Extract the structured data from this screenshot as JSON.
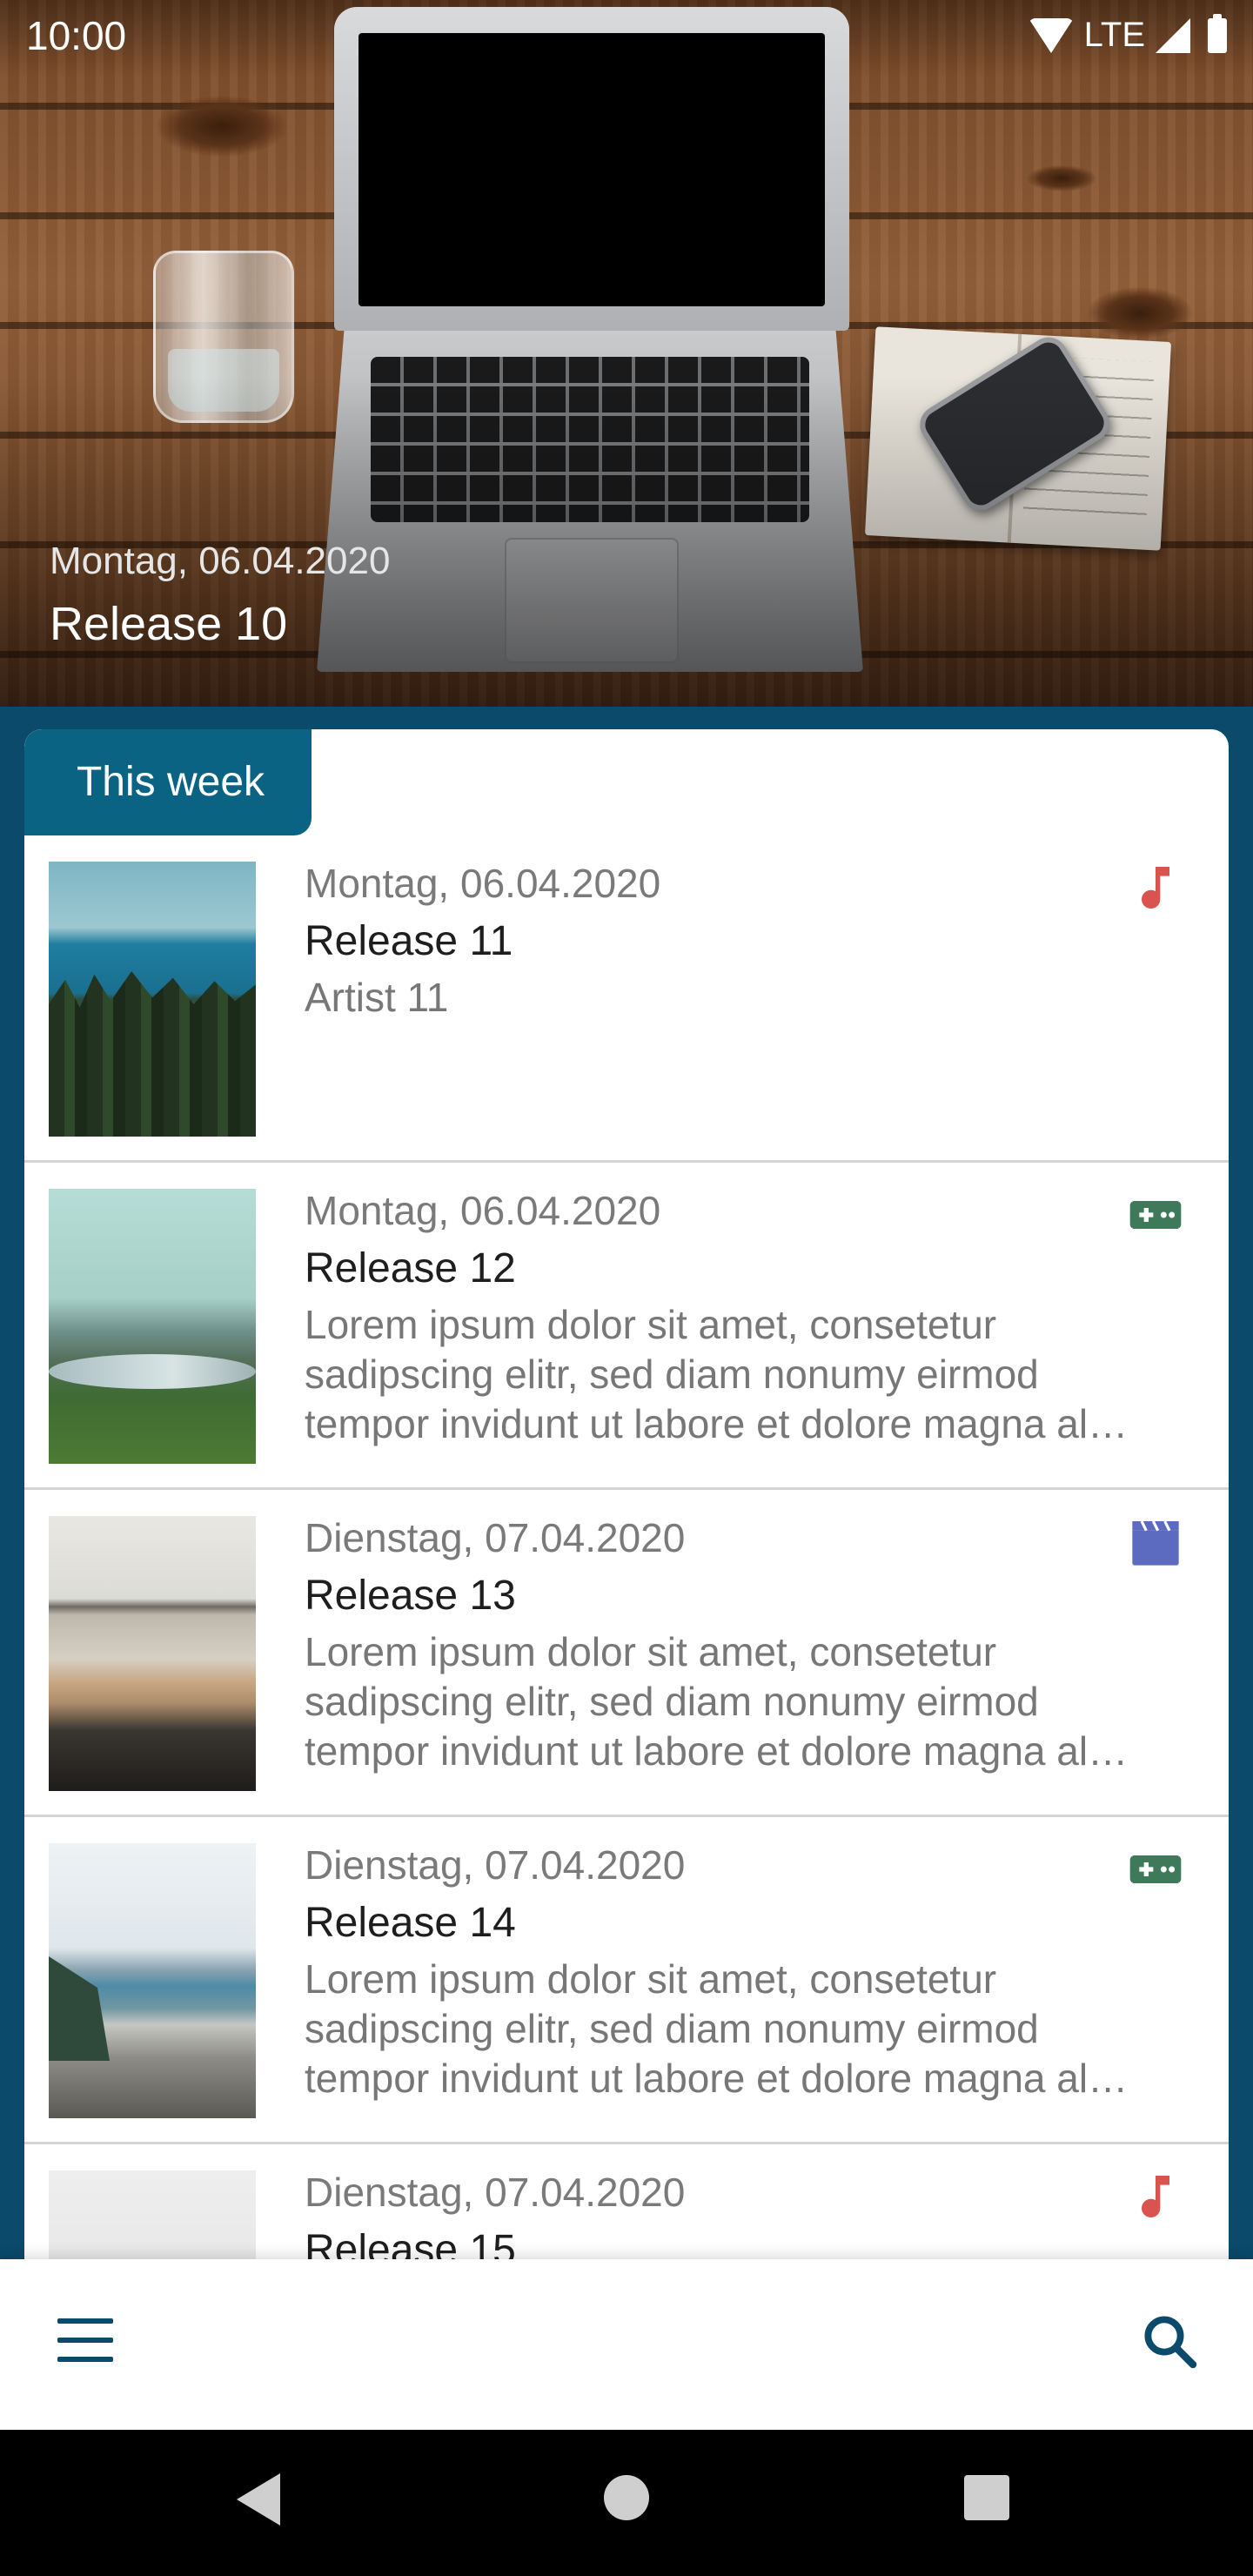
{
  "status_bar": {
    "time": "10:00",
    "network": "LTE"
  },
  "hero": {
    "date": "Montag, 06.04.2020",
    "title": "Release 10"
  },
  "section": {
    "tab_label": "This week"
  },
  "releases": [
    {
      "date": "Montag, 06.04.2020",
      "title": "Release 11",
      "subtitle": "Artist 11",
      "category": "music-note-icon",
      "category_color": "#d9534f",
      "desc": []
    },
    {
      "date": "Montag, 06.04.2020",
      "title": "Release 12",
      "subtitle": "",
      "category": "gamepad-icon",
      "category_color": "#3e7a5a",
      "desc": [
        "Lorem ipsum dolor sit amet, consetetur",
        "sadipscing elitr, sed diam nonumy eirmod",
        "tempor invidunt ut labore et dolore magna al…"
      ]
    },
    {
      "date": "Dienstag, 07.04.2020",
      "title": "Release 13",
      "subtitle": "",
      "category": "clapperboard-icon",
      "category_color": "#5c6bc0",
      "desc": [
        "Lorem ipsum dolor sit amet, consetetur",
        "sadipscing elitr, sed diam nonumy eirmod",
        "tempor invidunt ut labore et dolore magna al…"
      ]
    },
    {
      "date": "Dienstag, 07.04.2020",
      "title": "Release 14",
      "subtitle": "",
      "category": "gamepad-icon",
      "category_color": "#3e7a5a",
      "desc": [
        "Lorem ipsum dolor sit amet, consetetur",
        "sadipscing elitr, sed diam nonumy eirmod",
        "tempor invidunt ut labore et dolore magna al…"
      ]
    },
    {
      "date": "Dienstag, 07.04.2020",
      "title": "Release 15",
      "subtitle": "",
      "category": "music-note-icon",
      "category_color": "#d9534f",
      "desc": []
    }
  ],
  "bottom_bar": {
    "menu": "hamburger-menu-icon",
    "search": "search-icon"
  },
  "colors": {
    "primary": "#0b4a6b",
    "tab": "#0b6383"
  }
}
